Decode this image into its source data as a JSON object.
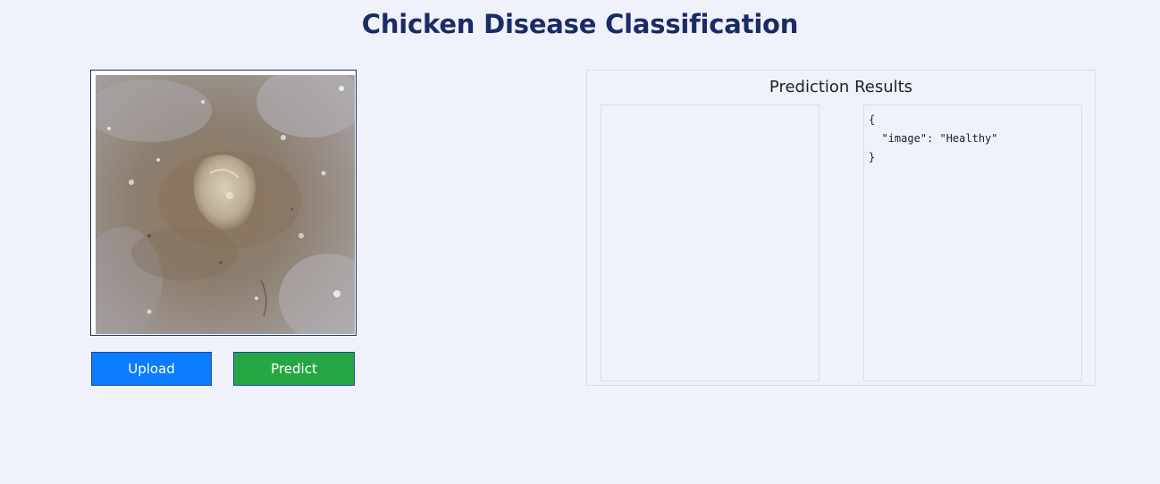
{
  "header": {
    "title": "Chicken Disease Classification"
  },
  "actions": {
    "upload_label": "Upload",
    "predict_label": "Predict"
  },
  "results": {
    "title": "Prediction Results",
    "json_text": "{\n  \"image\": \"Healthy\"\n}"
  },
  "colors": {
    "title": "#1a2b66",
    "upload_button": "#0b7bff",
    "predict_button": "#27a744",
    "background": "#eff2fa"
  }
}
